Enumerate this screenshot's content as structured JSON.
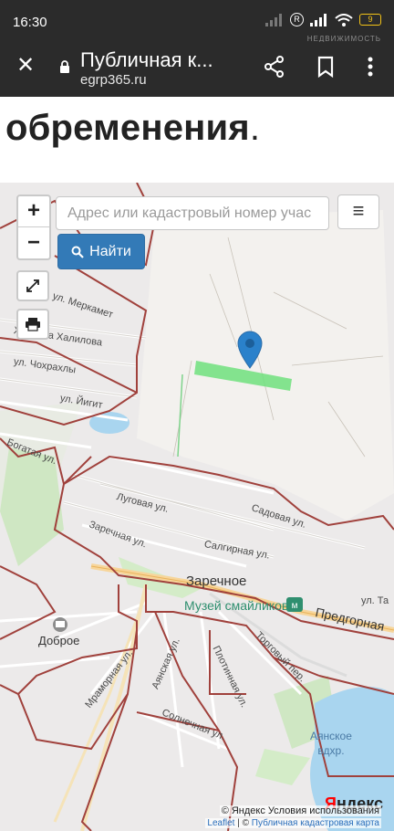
{
  "status_bar": {
    "time": "16:30",
    "watermark": "НЕДВИЖИМОСТЬ",
    "battery": "9",
    "reg_mark": "R",
    "icons": [
      "signal-icon",
      "wifi-icon",
      "battery-icon"
    ]
  },
  "browser": {
    "title": "Публичная к...",
    "url": "egrp365.ru",
    "icons": [
      "close-icon",
      "lock-icon",
      "share-icon",
      "bookmark-icon",
      "more-icon"
    ]
  },
  "page": {
    "heading": "обременения",
    "heading_period": "."
  },
  "map": {
    "zoom_in": "+",
    "zoom_out": "−",
    "search_placeholder": "Адрес или кадастровый номер учас",
    "layers_icon": "≡",
    "find_label": "Найти",
    "streets": [
      "ул. Меркамет",
      "Хайдара Халилова",
      "ул. Чохрахлы",
      "ул. Йигит",
      "Богатая ул.",
      "Луговая ул.",
      "Заречная ул.",
      "Садовая ул.",
      "Салгирная ул.",
      "ул. Та",
      "Торговый пер.",
      "Мраморная ул.",
      "Аянская ул.",
      "Плотинная ул.",
      "Солнечная ул."
    ],
    "places": {
      "village": "Заречное",
      "dobroe": "Доброе",
      "museum": "Музей смайликов",
      "road": "Предгорная",
      "reservoir_line1": "Аянское",
      "reservoir_line2": "вдхр."
    },
    "yandex_logo_first": "Я",
    "yandex_logo_rest": "ндекс",
    "attribution_line1": "© Яндекс  Условия использования",
    "attribution_leaflet": "Leaflet",
    "attribution_sep": " | © ",
    "attribution_source": "Публичная кадастровая карта"
  }
}
